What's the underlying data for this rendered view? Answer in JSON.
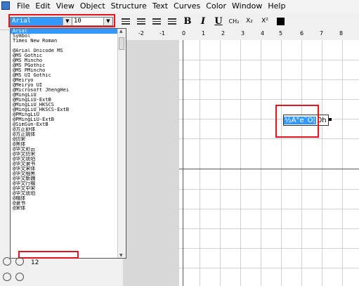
{
  "menubar": {
    "items": [
      "File",
      "Edit",
      "View",
      "Object",
      "Structure",
      "Text",
      "Curves",
      "Color",
      "Window",
      "Help"
    ]
  },
  "toolbar": {
    "font_value": "Arial",
    "size_value": "10",
    "bold": "B",
    "italic": "I",
    "underline": "U",
    "chem": "CH₂",
    "subscript": "X₂",
    "superscript": "X²"
  },
  "ruler": {
    "ticks": [
      "-2",
      "-1",
      "0",
      "1",
      "2",
      "3",
      "4",
      "5",
      "6",
      "7",
      "8"
    ]
  },
  "font_list": {
    "items": [
      "Arial",
      "Symbol",
      "Times New Roman",
      "",
      "@Arial Unicode MS",
      "@MS Gothic",
      "@MS Mincho",
      "@MS PGothic",
      "@MS PMincho",
      "@MS UI Gothic",
      "@Meiryo",
      "@Meiryo UI",
      "@Microsoft JhengHei",
      "@MingLiU",
      "@MingLiU-ExtB",
      "@MingLiU_HKSCS",
      "@MingLiU_HKSCS-ExtB",
      "@PMingLiU",
      "@PMingLiU-ExtB",
      "@SimSun-ExtB",
      "@方正舒体",
      "@方正姚体",
      "@仿宋",
      "@黑体",
      "@华文彩云",
      "@华文仿宋",
      "@华文琥珀",
      "@华文隶书",
      "@华文宋体",
      "@华文细黑",
      "@华文新魏",
      "@华文行楷",
      "@华文中宋",
      "@华文琥珀",
      "@楷体",
      "@隶书",
      "@宋体"
    ],
    "selected_index": 0
  },
  "canvas": {
    "text_selected": "½Â°e¨Ó¦",
    "text_rest": "0h"
  },
  "bottom": {
    "number": "12"
  },
  "colors": {
    "highlight": "#e8141c",
    "selection": "#3399ff"
  }
}
